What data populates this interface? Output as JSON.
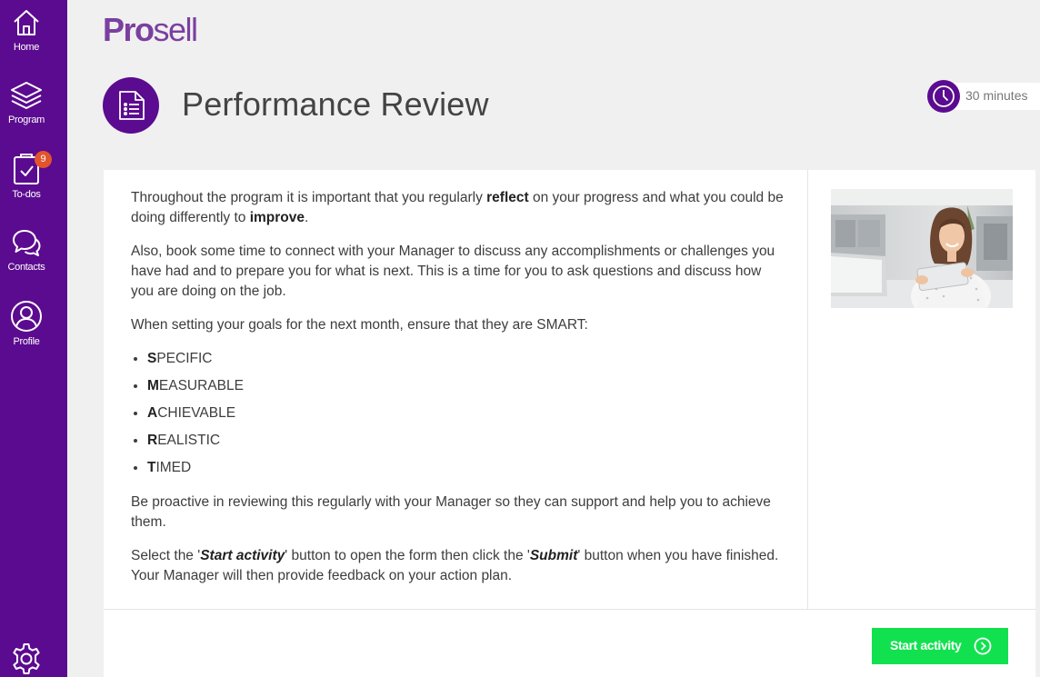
{
  "sidebar": {
    "items": [
      {
        "label": "Home",
        "icon": "home-icon"
      },
      {
        "label": "Program",
        "icon": "layers-icon"
      },
      {
        "label": "To-dos",
        "icon": "clipboard-check-icon",
        "badge": "9"
      },
      {
        "label": "Contacts",
        "icon": "chat-bubbles-icon"
      },
      {
        "label": "Profile",
        "icon": "user-circle-icon"
      }
    ],
    "settings_icon": "gear-icon"
  },
  "brand": {
    "bold": "Pro",
    "light": "sell"
  },
  "header": {
    "title": "Performance Review",
    "duration": "30 minutes"
  },
  "content": {
    "p1": {
      "a": "Throughout the program it is important that you regularly ",
      "b": "reflect",
      "c": " on your progress and what you could be doing differently to ",
      "d": "improve",
      "e": "."
    },
    "p2": "Also, book some time to connect with your Manager to discuss any accomplishments or challenges you have had and to prepare you for what is next. This is a time for you to ask questions and discuss how you are doing on the job.",
    "p3": "When setting your goals for the next month, ensure that they are SMART:",
    "smart": [
      {
        "initial": "S",
        "rest": "PECIFIC"
      },
      {
        "initial": "M",
        "rest": "EASURABLE"
      },
      {
        "initial": "A",
        "rest": "CHIEVABLE"
      },
      {
        "initial": "R",
        "rest": "EALISTIC"
      },
      {
        "initial": "T",
        "rest": "IMED"
      }
    ],
    "p4": "Be proactive in reviewing this regularly with your Manager so they can support and help you to achieve them.",
    "p5": {
      "a": "Select the '",
      "b": "Start activity",
      "c": "' button to open the form then click the '",
      "d": "Submit",
      "e": "' button when you have finished. Your Manager will then provide feedback on your action plan."
    }
  },
  "actions": {
    "start_label": "Start activity"
  },
  "colors": {
    "brand_purple": "#5b0b8f",
    "logo_purple": "#7b3fa0",
    "button_green": "#12e14f",
    "badge_orange": "#e2542c"
  }
}
